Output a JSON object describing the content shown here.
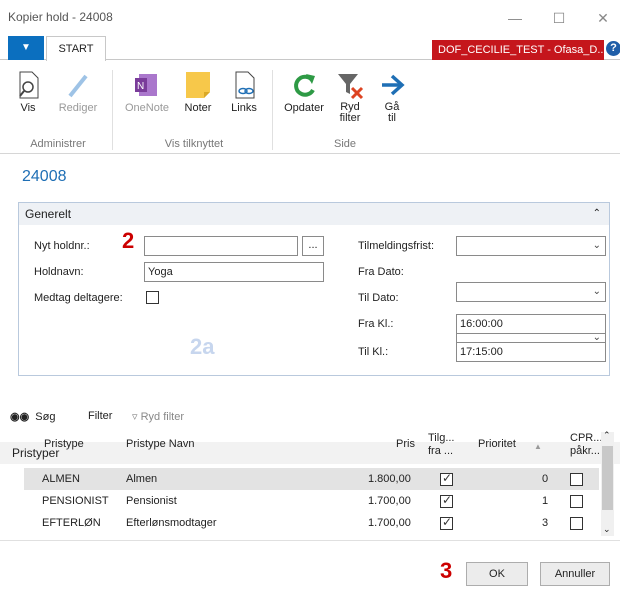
{
  "window": {
    "title": "Kopier hold - 24008",
    "minimize": "—",
    "maximize": "☐",
    "close": "✕"
  },
  "ribbon": {
    "file_icon": "dropdown-arrow-icon",
    "tab": "START",
    "company": "DOF_CECILIE_TEST - Ofasa_D...",
    "help": "?",
    "buttons": {
      "vis": "Vis",
      "rediger": "Rediger",
      "onenote": "OneNote",
      "noter": "Noter",
      "links": "Links",
      "opdater": "Opdater",
      "ryd_filter_1": "Ryd",
      "ryd_filter_2": "filter",
      "gaa_til_1": "Gå",
      "gaa_til_2": "til"
    },
    "groups": {
      "administrer": "Administrer",
      "vis_tilknyttet": "Vis tilknyttet",
      "side": "Side"
    }
  },
  "page": {
    "title": "24008"
  },
  "generelt": {
    "header": "Generelt",
    "annotation_2": "2",
    "annotation_2a": "2a",
    "nyt_holdnr_label": "Nyt holdnr.:",
    "nyt_holdnr_value": "",
    "lookup_btn": "...",
    "holdnavn_label": "Holdnavn:",
    "holdnavn_value": "Yoga",
    "medtag_label": "Medtag deltagere:",
    "tilmeldingsfrist_label": "Tilmeldingsfrist:",
    "fra_dato_label": "Fra Dato:",
    "til_dato_label": "Til Dato:",
    "fra_kl_label": "Fra Kl.:",
    "fra_kl_value": "16:00:00",
    "til_kl_label": "Til Kl.:",
    "til_kl_value": "17:15:00"
  },
  "pristyper": {
    "header": "Pristyper",
    "soeg": "Søg",
    "filter": "Filter",
    "ryd_filter": "Ryd filter",
    "columns": {
      "pristype": "Pristype",
      "navn": "Pristype Navn",
      "pris": "Pris",
      "tilg_1": "Tilg...",
      "tilg_2": "fra ...",
      "prioritet": "Prioritet",
      "cpr_1": "CPR...",
      "cpr_2": "påkr..."
    },
    "rows": [
      {
        "pristype": "ALMEN",
        "navn": "Almen",
        "pris": "1.800,00",
        "prioritet": "0"
      },
      {
        "pristype": "PENSIONIST",
        "navn": "Pensionist",
        "pris": "1.700,00",
        "prioritet": "1"
      },
      {
        "pristype": "EFTERLØN",
        "navn": "Efterlønsmodtager",
        "pris": "1.700,00",
        "prioritet": "3"
      }
    ]
  },
  "footer": {
    "annotation_3": "3",
    "ok": "OK",
    "annuller": "Annuller"
  }
}
